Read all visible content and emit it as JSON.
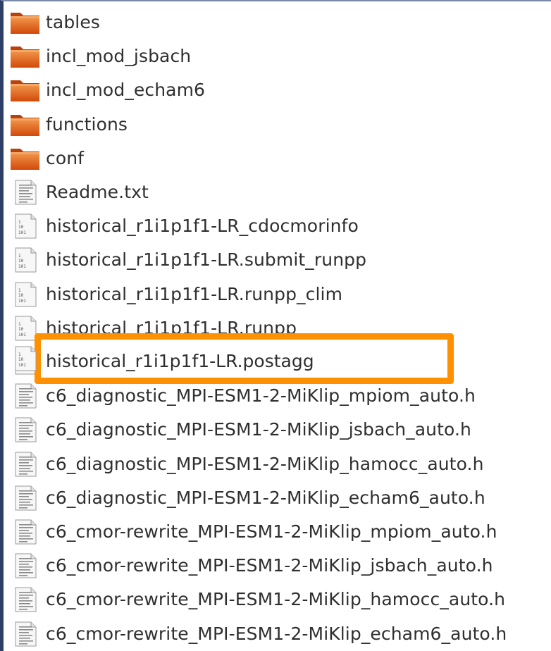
{
  "files": [
    {
      "name": "tables",
      "icon": "folder-icon"
    },
    {
      "name": "incl_mod_jsbach",
      "icon": "folder-icon"
    },
    {
      "name": "incl_mod_echam6",
      "icon": "folder-icon"
    },
    {
      "name": "functions",
      "icon": "folder-icon"
    },
    {
      "name": "conf",
      "icon": "folder-icon"
    },
    {
      "name": "Readme.txt",
      "icon": "text-file-icon"
    },
    {
      "name": "historical_r1i1p1f1-LR_cdocmorinfo",
      "icon": "binary-file-icon"
    },
    {
      "name": "historical_r1i1p1f1-LR.submit_runpp",
      "icon": "binary-file-icon"
    },
    {
      "name": "historical_r1i1p1f1-LR.runpp_clim",
      "icon": "binary-file-icon"
    },
    {
      "name": "historical_r1i1p1f1-LR.runpp",
      "icon": "binary-file-icon"
    },
    {
      "name": "historical_r1i1p1f1-LR.postagg",
      "icon": "binary-file-icon",
      "highlighted": true
    },
    {
      "name": "c6_diagnostic_MPI-ESM1-2-MiKlip_mpiom_auto.h",
      "icon": "text-file-icon"
    },
    {
      "name": "c6_diagnostic_MPI-ESM1-2-MiKlip_jsbach_auto.h",
      "icon": "text-file-icon"
    },
    {
      "name": "c6_diagnostic_MPI-ESM1-2-MiKlip_hamocc_auto.h",
      "icon": "text-file-icon"
    },
    {
      "name": "c6_diagnostic_MPI-ESM1-2-MiKlip_echam6_auto.h",
      "icon": "text-file-icon"
    },
    {
      "name": "c6_cmor-rewrite_MPI-ESM1-2-MiKlip_mpiom_auto.h",
      "icon": "text-file-icon"
    },
    {
      "name": "c6_cmor-rewrite_MPI-ESM1-2-MiKlip_jsbach_auto.h",
      "icon": "text-file-icon"
    },
    {
      "name": "c6_cmor-rewrite_MPI-ESM1-2-MiKlip_hamocc_auto.h",
      "icon": "text-file-icon"
    },
    {
      "name": "c6_cmor-rewrite_MPI-ESM1-2-MiKlip_echam6_auto.h",
      "icon": "text-file-icon"
    }
  ],
  "colors": {
    "highlight": "#ff9100",
    "folder_top": "#f08a3c",
    "folder_bottom": "#d94f0a",
    "text": "#2f2f2f"
  }
}
